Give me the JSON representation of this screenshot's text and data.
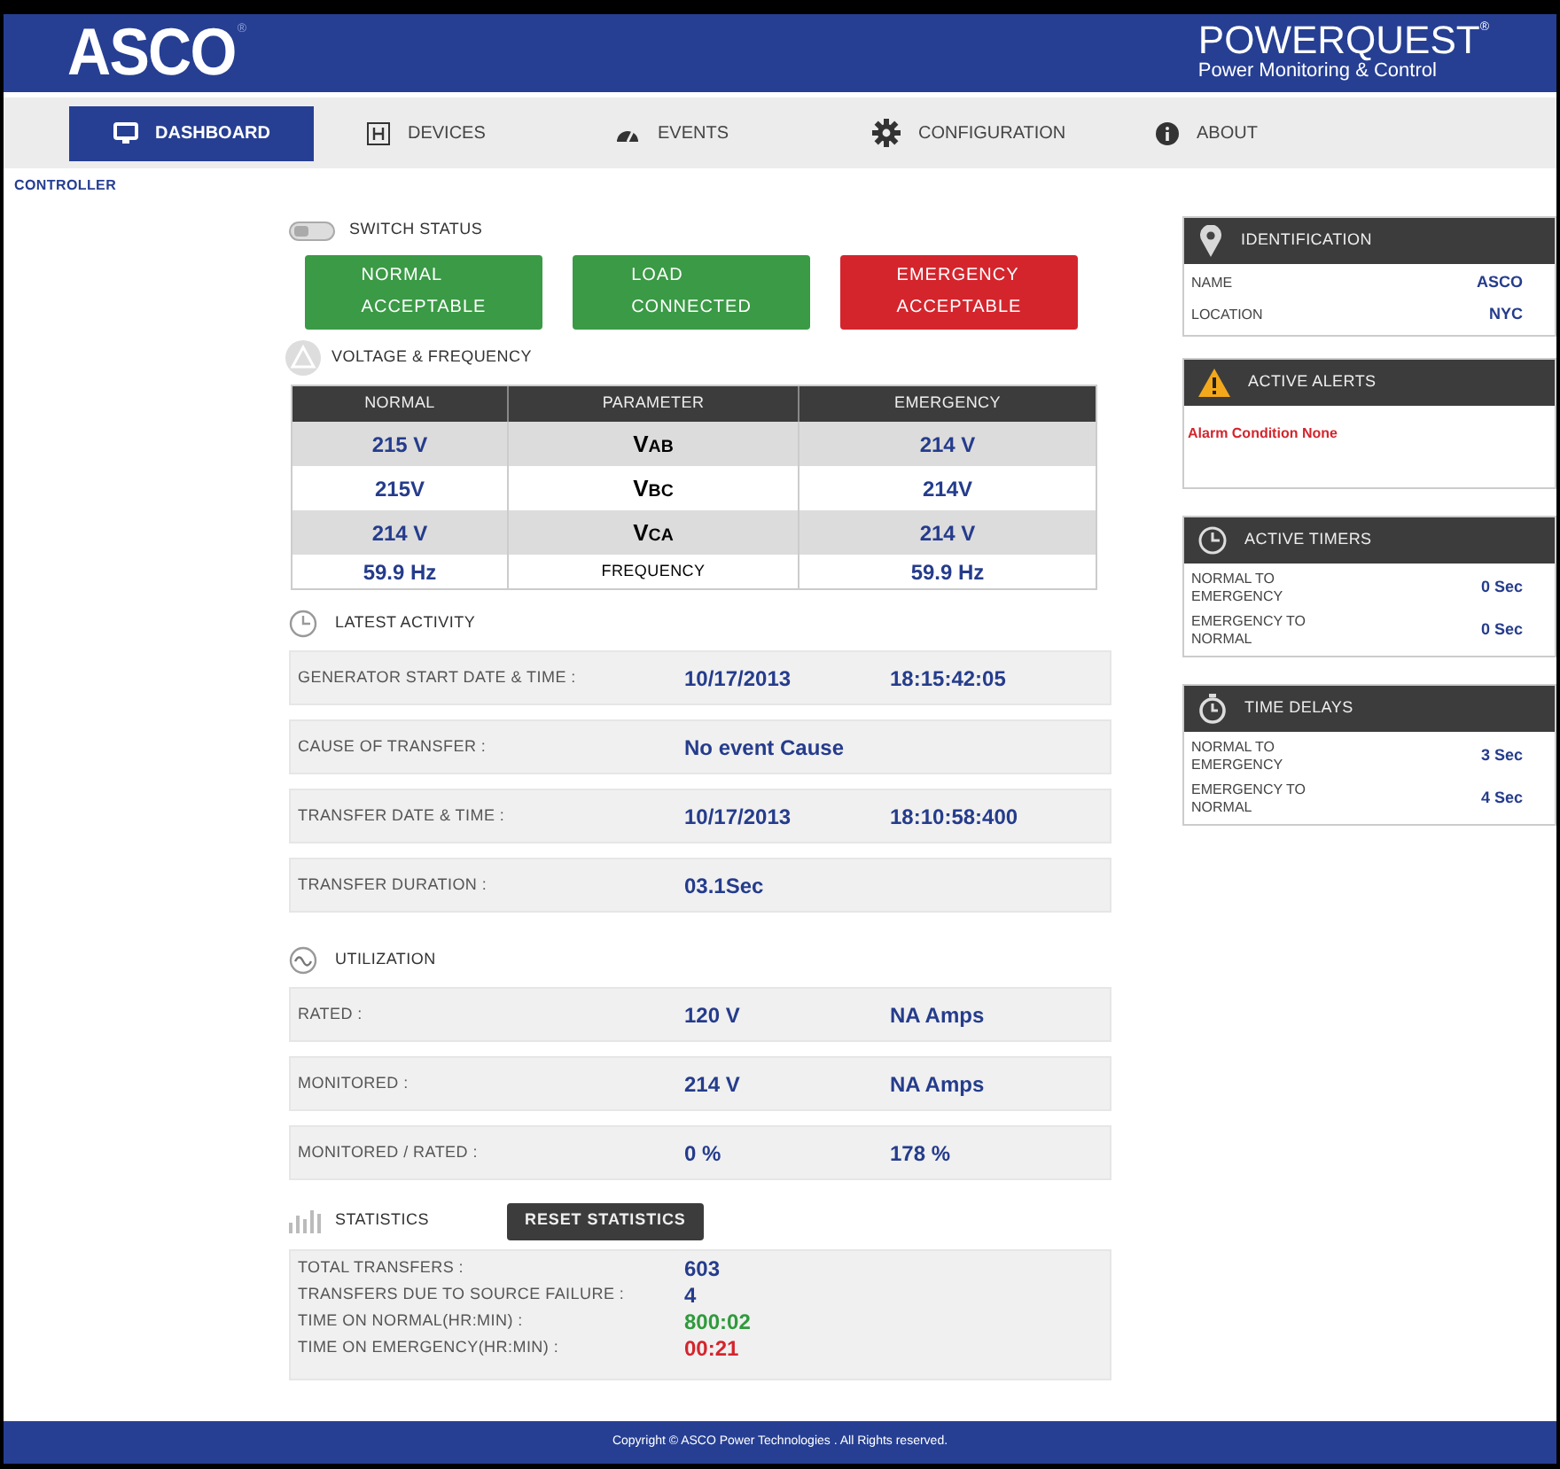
{
  "header": {
    "logo": "ASCO",
    "logo_mark": "®",
    "product": "POWERQUEST",
    "product_mark": "®",
    "tagline": "Power Monitoring & Control"
  },
  "nav": [
    {
      "label": "DASHBOARD",
      "selected": true
    },
    {
      "label": "DEVICES",
      "selected": false
    },
    {
      "label": "EVENTS",
      "selected": false
    },
    {
      "label": "CONFIGURATION",
      "selected": false
    },
    {
      "label": "ABOUT",
      "selected": false
    }
  ],
  "breadcrumb": "CONTROLLER",
  "switch_status": {
    "title": "SWITCH STATUS",
    "tiles": [
      {
        "line1": "NORMAL",
        "line2": "ACCEPTABLE",
        "color": "#3a9a45"
      },
      {
        "line1": "LOAD",
        "line2": "CONNECTED",
        "color": "#3a9a45"
      },
      {
        "line1": "EMERGENCY",
        "line2": "ACCEPTABLE",
        "color": "#d4252d"
      }
    ]
  },
  "voltage_frequency": {
    "title": "VOLTAGE & FREQUENCY",
    "columns": [
      "NORMAL",
      "PARAMETER",
      "EMERGENCY"
    ],
    "rows": [
      {
        "normal": "215 V",
        "parameter": "V$_{AB}$",
        "kind": "voltage",
        "emergency": "214 V"
      },
      {
        "normal": "215V",
        "parameter": "V$_{BC}$",
        "kind": "voltage",
        "emergency": "214V"
      },
      {
        "normal": "214 V",
        "parameter": "V$_{CA}$",
        "kind": "voltage",
        "emergency": "214 V"
      },
      {
        "normal": "59.9 Hz",
        "parameter": "FREQUENCY",
        "kind": "frequency",
        "emergency": "59.9 Hz"
      }
    ]
  },
  "latest_activity": {
    "title": "LATEST ACTIVITY",
    "rows": [
      {
        "label": "GENERATOR START DATE & TIME :",
        "value_1": "10/17/2013",
        "value_2": "18:15:42:05"
      },
      {
        "label": "CAUSE OF TRANSFER :",
        "value_1": "No event Cause"
      },
      {
        "label": "TRANSFER DATE & TIME :",
        "value_1": "10/17/2013",
        "value_2": "18:10:58:400"
      },
      {
        "label": "TRANSFER DURATION :",
        "value_1": "03.1Sec"
      }
    ]
  },
  "utilization": {
    "title": "UTILIZATION",
    "rows": [
      {
        "label": "RATED :",
        "value_1": "120 V",
        "value_2": "NA Amps"
      },
      {
        "label": "MONITORED :",
        "value_1": "214 V",
        "value_2": "NA Amps"
      },
      {
        "label": "MONITORED / RATED :",
        "value_1": "0 %",
        "value_2": "178 %"
      }
    ]
  },
  "statistics": {
    "title": "STATISTICS",
    "reset_button": "RESET STATISTICS",
    "rows": [
      {
        "label": "TOTAL TRANSFERS :",
        "value": "603",
        "color": "#253c8c"
      },
      {
        "label": "TRANSFERS DUE TO SOURCE FAILURE :",
        "value": "4",
        "color": "#253c8c"
      },
      {
        "label": "TIME ON NORMAL(HR:MIN) :",
        "value": "800:02",
        "color": "#2f9a3c"
      },
      {
        "label": "TIME ON EMERGENCY(HR:MIN) :",
        "value": "00:21",
        "color": "#d4252d"
      }
    ]
  },
  "side_panels": [
    {
      "title": "IDENTIFICATION",
      "kind": "pairs",
      "rows": [
        {
          "label": "NAME",
          "value": "ASCO"
        },
        {
          "label": "LOCATION",
          "value": "NYC"
        }
      ]
    },
    {
      "title": "ACTIVE ALERTS",
      "kind": "message",
      "message": "Alarm Condition None"
    },
    {
      "title": "ACTIVE TIMERS",
      "kind": "pairs",
      "rows": [
        {
          "label": "NORMAL TO EMERGENCY",
          "value": "0 Sec"
        },
        {
          "label": "EMERGENCY TO NORMAL",
          "value": "0 Sec"
        }
      ]
    },
    {
      "title": "TIME DELAYS",
      "kind": "pairs",
      "rows": [
        {
          "label": "NORMAL TO EMERGENCY",
          "value": "3 Sec"
        },
        {
          "label": "EMERGENCY TO NORMAL",
          "value": "4 Sec"
        }
      ]
    }
  ],
  "footer": "Copyright © ASCO Power Technologies . All Rights reserved."
}
